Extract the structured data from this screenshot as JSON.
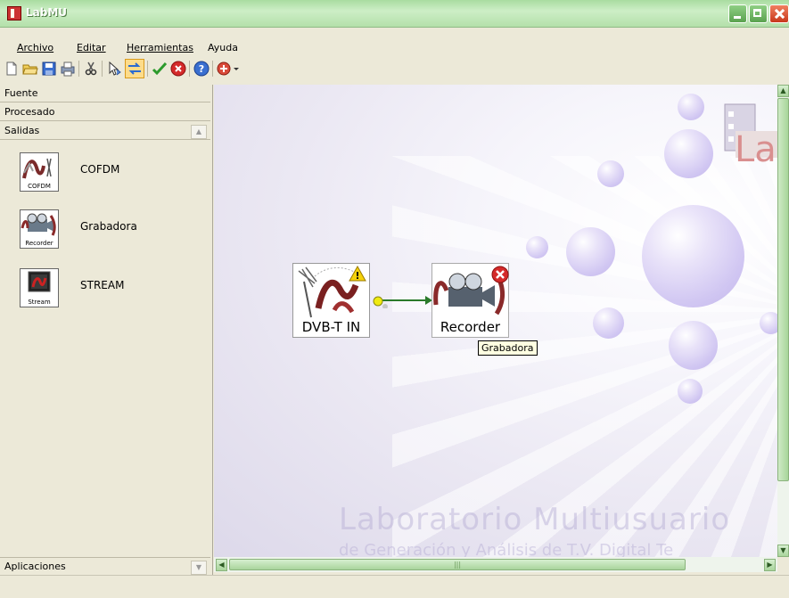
{
  "window": {
    "title": "LabMU"
  },
  "menu": {
    "items": [
      {
        "label": "Archivo"
      },
      {
        "label": "Editar"
      },
      {
        "label": "Herramientas"
      },
      {
        "label": "Ayuda"
      }
    ]
  },
  "toolbar": {
    "icons": [
      "new-file-icon",
      "open-folder-icon",
      "save-icon",
      "print-icon",
      "cut-icon",
      "pointer-icon",
      "connect-icon",
      "check-icon",
      "stop-icon",
      "help-icon",
      "tools-dropdown-icon"
    ]
  },
  "sidebar": {
    "groups": [
      {
        "label": "Fuente"
      },
      {
        "label": "Procesado"
      },
      {
        "label": "Salidas"
      }
    ],
    "items": [
      {
        "label": "COFDM",
        "caption": "COFDM"
      },
      {
        "label": "Grabadora",
        "caption": "Recorder"
      },
      {
        "label": "STREAM",
        "caption": "Stream"
      }
    ],
    "bottom_group": {
      "label": "Aplicaciones"
    }
  },
  "canvas": {
    "watermark_title": "Laboratorio Multiusuario",
    "watermark_subtitle": "de Generación y Análisis de T.V. Digital Te",
    "logo_text": "Lab",
    "nodes": [
      {
        "label": "DVB-T IN",
        "status": "warning"
      },
      {
        "label": "Recorder",
        "status": "error"
      }
    ],
    "tooltip": "Grabadora"
  },
  "colors": {
    "titlebar": "#b4e0aa",
    "connection": "#2a7a2a",
    "port": "#e8e000"
  }
}
